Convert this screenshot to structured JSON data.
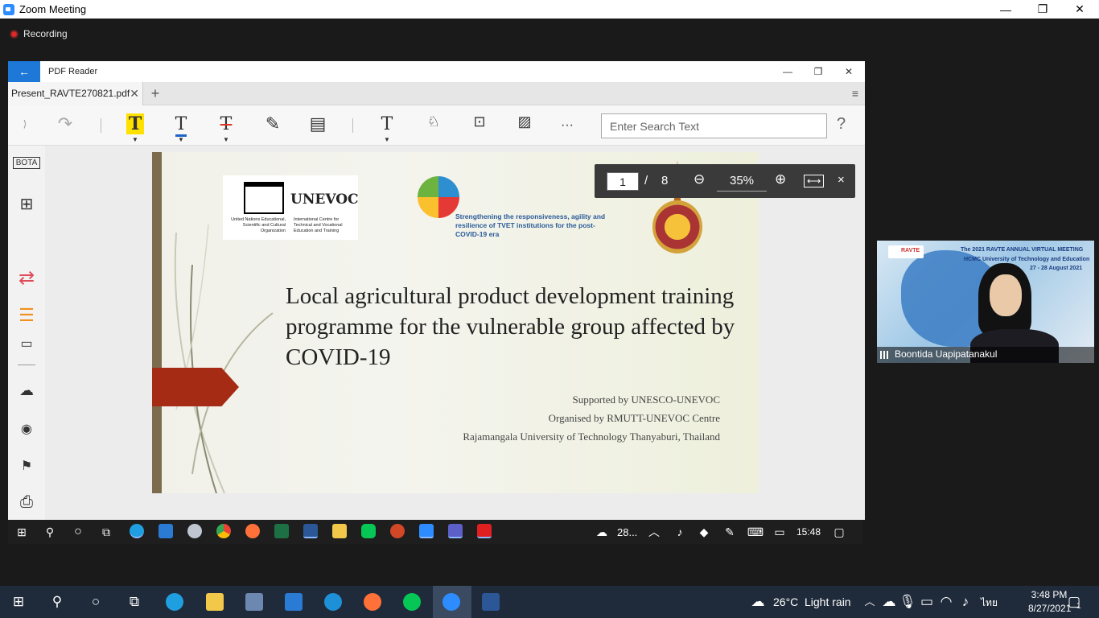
{
  "zoom": {
    "title": "Zoom Meeting",
    "recording": "Recording",
    "controls": {
      "minimize": "—",
      "restore": "❐",
      "close": "✕"
    }
  },
  "pdf_reader": {
    "app_title": "PDF Reader",
    "back_icon": "←",
    "window_controls": {
      "minimize": "—",
      "restore": "❐",
      "close": "✕"
    },
    "tab": {
      "filename": "Present_RAVTE270821.pdf",
      "close": "✕"
    },
    "tab_add": "+",
    "tab_menu": "≡",
    "toolbar": {
      "undo": "⟩",
      "redo": "↷",
      "highlight": "T",
      "underline": "T",
      "strikethrough": "T",
      "pen": "✎",
      "note": "▤",
      "textbox": "T",
      "stamp": "♘",
      "briefcase": "⊡",
      "sign": "▨",
      "more": "···",
      "search_placeholder": "Enter Search Text",
      "help": "?"
    },
    "sidebar": {
      "bota": "BOTA",
      "grid": "⊞",
      "convert": "⇄",
      "tools": "☰",
      "present": "▭",
      "cloud": "☁",
      "eye": "◉",
      "bookmark": "⚑",
      "print": "⎙"
    },
    "slide": {
      "unesco_logo_text": "UNEVOC",
      "unesco_sub_left": "United Nations Educational, Scientific and Cultural Organization",
      "unesco_sub_right": "International Centre for Technical and Vocational Education and Training",
      "tagline": "Strengthening the responsiveness, agility and resilience of TVET institutions for the post-COVID-19 era",
      "title": "Local agricultural product development training programme for the vulnerable group affected by COVID-19",
      "credits": [
        "Supported by UNESCO-UNEVOC",
        "Organised by RMUTT-UNEVOC Centre",
        "Rajamangala University of Technology Thanyaburi, Thailand"
      ]
    },
    "pagebar": {
      "current_page": "1",
      "separator": "/",
      "total_pages": "8",
      "zoom_out": "⊖",
      "zoom": "35%",
      "zoom_in": "⊕",
      "fit_width": "⟷",
      "close": "×"
    }
  },
  "inner_taskbar": {
    "weather": "28...",
    "time": "15:48"
  },
  "video": {
    "participant_name": "Boontida Uapipatanakul",
    "banner_title": "The 2021 RAVTE ANNUAL VIRTUAL MEETING",
    "banner_sub": "HCMC University of Technology and Education",
    "banner_date": "27 - 28 August 2021",
    "logo": "RAVTE"
  },
  "taskbar": {
    "weather_temp": "26°C",
    "weather_desc": "Light rain",
    "lang": "ไทย",
    "time": "3:48 PM",
    "date": "8/27/2021",
    "notifications": "1"
  },
  "colors": {
    "accent": "#1e78d7",
    "slide_arrow": "#a62b14",
    "recording": "#e02828"
  }
}
